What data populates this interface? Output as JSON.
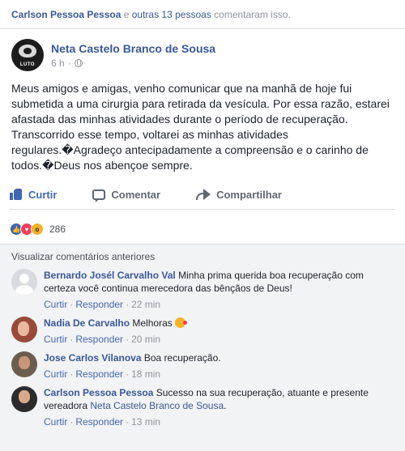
{
  "topbar": {
    "author": "Carlson Pessoa Pessoa",
    "connector": " e ",
    "others": "outras 13 pessoas",
    "suffix": " comentaram isso."
  },
  "post": {
    "author": "Neta Castelo Branco de Sousa",
    "avatar_text": "LUTO",
    "time": "6 h",
    "separator": "·",
    "privacy_icon": "globe-icon",
    "body": "Meus amigos e amigas, venho comunicar que na manhã de hoje fui submetida a uma cirurgia para retirada da vesícula. Por essa razão, estarei afastada das minhas atividades durante o período de recuperação. Transcorrido esse tempo, voltarei as minhas atividades regulares.�Agradeço antecipadamente a compreensão e o carinho de todos.�Deus nos abençoe sempre."
  },
  "actions": {
    "like": "Curtir",
    "comment": "Comentar",
    "share": "Compartilhar"
  },
  "reactions": {
    "count": "286",
    "types": [
      "like",
      "love",
      "wow"
    ]
  },
  "comments_section": {
    "view_previous": "Visualizar comentários anteriores",
    "like_label": "Curtir",
    "reply_label": "Responder",
    "comments": [
      {
        "author": "Bernardo Josél Carvalho Val",
        "text": "Minha prima querida boa recuperação com certeza você continua merecedora das bênçãos de Deus!",
        "time": "22 min"
      },
      {
        "author": "Nadia De Carvalho",
        "text": "Melhoras",
        "time": "20 min"
      },
      {
        "author": "Jose Carlos Vilanova",
        "text": "Boa recuperação.",
        "time": "18 min"
      },
      {
        "author": "Carlson Pessoa Pessoa",
        "text": "Sucesso na sua recuperação, atuante e presente vereadora",
        "mention": "Neta Castelo Branco de Sousa",
        "text_end": ".",
        "time": "13 min"
      }
    ]
  },
  "colors": {
    "link": "#385898",
    "accent": "#4267b2",
    "muted": "#90949c",
    "comments_bg": "#f2f3f5"
  }
}
